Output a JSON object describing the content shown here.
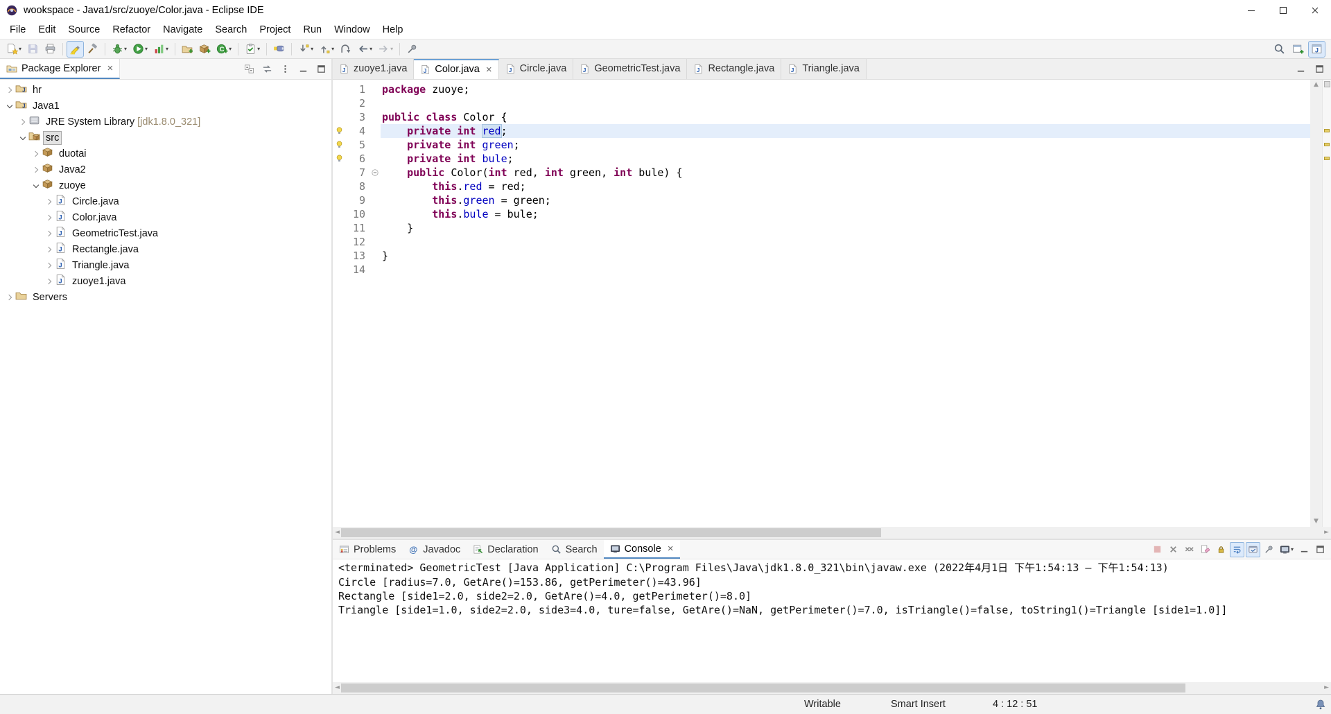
{
  "window": {
    "title": "wookspace - Java1/src/zuoye/Color.java - Eclipse IDE"
  },
  "menubar": {
    "items": [
      "File",
      "Edit",
      "Source",
      "Refactor",
      "Navigate",
      "Search",
      "Project",
      "Run",
      "Window",
      "Help"
    ]
  },
  "toolbar": {
    "buttons": [
      {
        "name": "new-wizard",
        "dropdown": true
      },
      {
        "name": "save",
        "disabled": true
      },
      {
        "name": "print"
      },
      {
        "sep": true
      },
      {
        "name": "mark-occurrences",
        "toggled": true
      },
      {
        "name": "build-all"
      },
      {
        "sep": true
      },
      {
        "name": "debug",
        "dropdown": true
      },
      {
        "name": "run",
        "dropdown": true
      },
      {
        "name": "coverage",
        "dropdown": true
      },
      {
        "sep": true
      },
      {
        "name": "new-java-project"
      },
      {
        "name": "new-package"
      },
      {
        "name": "new-class",
        "dropdown": true
      },
      {
        "sep": true
      },
      {
        "name": "open-task",
        "dropdown": true
      },
      {
        "sep": true
      },
      {
        "name": "search"
      },
      {
        "sep": true
      },
      {
        "name": "next-annotation",
        "dropdown": true
      },
      {
        "name": "prev-annotation",
        "dropdown": true
      },
      {
        "name": "last-edit-location"
      },
      {
        "name": "back",
        "dropdown": true
      },
      {
        "name": "forward",
        "dropdown": true,
        "disabled": true
      },
      {
        "sep": true
      },
      {
        "name": "pin-editor"
      }
    ],
    "right": [
      {
        "name": "search-all"
      },
      {
        "name": "open-perspective"
      },
      {
        "name": "java-perspective",
        "toggled": true
      }
    ]
  },
  "package_explorer": {
    "tab_label": "Package Explorer",
    "actions": [
      {
        "name": "collapse-all"
      },
      {
        "name": "link-with-editor"
      },
      {
        "name": "view-menu"
      },
      {
        "name": "minimize-panel"
      },
      {
        "name": "maximize-panel"
      }
    ],
    "tree": [
      {
        "label": "hr",
        "depth": 0,
        "expand": "closed",
        "icon": "project"
      },
      {
        "label": "Java1",
        "depth": 0,
        "expand": "open",
        "icon": "project"
      },
      {
        "label": "JRE System Library",
        "suffix": " [jdk1.8.0_321]",
        "depth": 1,
        "expand": "closed",
        "icon": "library"
      },
      {
        "label": "src",
        "depth": 1,
        "expand": "open",
        "icon": "srcfolder",
        "selected": true
      },
      {
        "label": "duotai",
        "depth": 2,
        "expand": "closed",
        "icon": "package"
      },
      {
        "label": "Java2",
        "depth": 2,
        "expand": "closed",
        "icon": "package"
      },
      {
        "label": "zuoye",
        "depth": 2,
        "expand": "open",
        "icon": "package"
      },
      {
        "label": "Circle.java",
        "depth": 3,
        "expand": "closed",
        "icon": "jfile"
      },
      {
        "label": "Color.java",
        "depth": 3,
        "expand": "closed",
        "icon": "jfile"
      },
      {
        "label": "GeometricTest.java",
        "depth": 3,
        "expand": "closed",
        "icon": "jfile"
      },
      {
        "label": "Rectangle.java",
        "depth": 3,
        "expand": "closed",
        "icon": "jfile"
      },
      {
        "label": "Triangle.java",
        "depth": 3,
        "expand": "closed",
        "icon": "jfile"
      },
      {
        "label": "zuoye1.java",
        "depth": 3,
        "expand": "closed",
        "icon": "jfile"
      },
      {
        "label": "Servers",
        "depth": 0,
        "expand": "closed",
        "icon": "folder"
      }
    ]
  },
  "editor": {
    "tabs": [
      {
        "label": "zuoye1.java"
      },
      {
        "label": "Color.java",
        "active": true
      },
      {
        "label": "Circle.java"
      },
      {
        "label": "GeometricTest.java"
      },
      {
        "label": "Rectangle.java"
      },
      {
        "label": "Triangle.java"
      }
    ],
    "tab_actions": [
      {
        "name": "minimize-panel"
      },
      {
        "name": "maximize-panel"
      }
    ],
    "lines": [
      {
        "n": 1,
        "tokens": [
          [
            "k",
            "package"
          ],
          [
            "d",
            " zuoye;"
          ]
        ]
      },
      {
        "n": 2,
        "tokens": []
      },
      {
        "n": 3,
        "tokens": [
          [
            "k",
            "public"
          ],
          [
            "d",
            " "
          ],
          [
            "k",
            "class"
          ],
          [
            "d",
            " Color {"
          ]
        ]
      },
      {
        "n": 4,
        "current": true,
        "marker": "warning",
        "tokens": [
          [
            "d",
            "    "
          ],
          [
            "k",
            "private"
          ],
          [
            "d",
            " "
          ],
          [
            "k",
            "int"
          ],
          [
            "d",
            " "
          ],
          [
            "fh",
            "red"
          ],
          [
            "d",
            ";"
          ]
        ]
      },
      {
        "n": 5,
        "marker": "warning",
        "tokens": [
          [
            "d",
            "    "
          ],
          [
            "k",
            "private"
          ],
          [
            "d",
            " "
          ],
          [
            "k",
            "int"
          ],
          [
            "d",
            " "
          ],
          [
            "f",
            "green"
          ],
          [
            "d",
            ";"
          ]
        ]
      },
      {
        "n": 6,
        "marker": "warning",
        "tokens": [
          [
            "d",
            "    "
          ],
          [
            "k",
            "private"
          ],
          [
            "d",
            " "
          ],
          [
            "k",
            "int"
          ],
          [
            "d",
            " "
          ],
          [
            "f",
            "bule"
          ],
          [
            "d",
            ";"
          ]
        ]
      },
      {
        "n": 7,
        "fold": true,
        "tokens": [
          [
            "d",
            "    "
          ],
          [
            "k",
            "public"
          ],
          [
            "d",
            " Color("
          ],
          [
            "k",
            "int"
          ],
          [
            "d",
            " red, "
          ],
          [
            "k",
            "int"
          ],
          [
            "d",
            " green, "
          ],
          [
            "k",
            "int"
          ],
          [
            "d",
            " bule) {"
          ]
        ]
      },
      {
        "n": 8,
        "tokens": [
          [
            "d",
            "        "
          ],
          [
            "k",
            "this"
          ],
          [
            "d",
            "."
          ],
          [
            "f",
            "red"
          ],
          [
            "d",
            " = red;"
          ]
        ]
      },
      {
        "n": 9,
        "tokens": [
          [
            "d",
            "        "
          ],
          [
            "k",
            "this"
          ],
          [
            "d",
            "."
          ],
          [
            "f",
            "green"
          ],
          [
            "d",
            " = green;"
          ]
        ]
      },
      {
        "n": 10,
        "tokens": [
          [
            "d",
            "        "
          ],
          [
            "k",
            "this"
          ],
          [
            "d",
            "."
          ],
          [
            "f",
            "bule"
          ],
          [
            "d",
            " = bule;"
          ]
        ]
      },
      {
        "n": 11,
        "tokens": [
          [
            "d",
            "    }"
          ]
        ]
      },
      {
        "n": 12,
        "tokens": []
      },
      {
        "n": 13,
        "tokens": [
          [
            "d",
            "}"
          ]
        ]
      },
      {
        "n": 14,
        "tokens": []
      }
    ]
  },
  "console": {
    "tabs": [
      {
        "label": "Problems",
        "icon": "problems"
      },
      {
        "label": "Javadoc",
        "icon": "javadoc"
      },
      {
        "label": "Declaration",
        "icon": "declaration"
      },
      {
        "label": "Search",
        "icon": "search-tab"
      },
      {
        "label": "Console",
        "icon": "console-tab",
        "active": true
      }
    ],
    "toolbar": [
      {
        "name": "stop",
        "disabled": true
      },
      {
        "name": "remove-launch"
      },
      {
        "name": "remove-all-launches"
      },
      {
        "name": "clear-console"
      },
      {
        "name": "scroll-lock"
      },
      {
        "name": "word-wrap",
        "toggled": true
      },
      {
        "name": "show-on-output",
        "toggled": true
      },
      {
        "name": "pin-console"
      },
      {
        "name": "open-console",
        "dropdown": true
      },
      {
        "name": "minimize-panel"
      },
      {
        "name": "maximize-panel"
      }
    ],
    "header": "<terminated> GeometricTest [Java Application] C:\\Program Files\\Java\\jdk1.8.0_321\\bin\\javaw.exe  (2022年4月1日 下午1:54:13 – 下午1:54:13)",
    "lines": [
      "Circle [radius=7.0, GetAre()=153.86, getPerimeter()=43.96]",
      "Rectangle [side1=2.0, side2=2.0, GetAre()=4.0, getPerimeter()=8.0]",
      "Triangle [side1=1.0, side2=2.0, side3=4.0, ture=false, GetAre()=NaN, getPerimeter()=7.0, isTriangle()=false, toString1()=Triangle [side1=1.0]]"
    ]
  },
  "status_bar": {
    "writable": "Writable",
    "insert_mode": "Smart Insert",
    "position": "4 : 12 : 51"
  },
  "colors": {
    "keyword": "#7f0055",
    "field": "#0000c0",
    "line_number": "#787878",
    "current_line": "#e4eefb",
    "accent": "#5288c1"
  }
}
